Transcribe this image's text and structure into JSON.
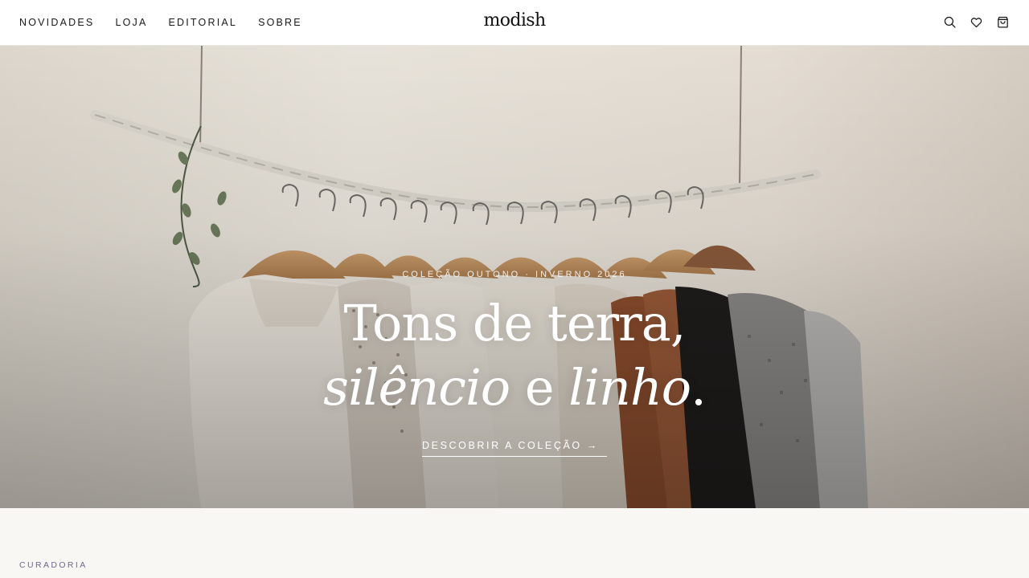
{
  "header": {
    "nav": [
      "NOVIDADES",
      "LOJA",
      "EDITORIAL",
      "SOBRE"
    ],
    "logo": "modish",
    "icons": [
      "search-icon",
      "heart-icon",
      "shopping-bag-icon"
    ]
  },
  "hero": {
    "eyebrow": "COLEÇÃO OUTONO · INVERNO 2026",
    "headline_line1": "Tons de terra,",
    "headline_italic1": "silêncio",
    "headline_mid": " e ",
    "headline_italic2": "linho",
    "headline_end": ".",
    "cta": "DESCOBRIR A COLEÇÃO →"
  },
  "section": {
    "label": "CURADORIA"
  },
  "colors": {
    "header_bg": "#ffffff",
    "page_bg": "#f8f7f4",
    "wall": "#e6e1d9",
    "section_label": "#6f6a8f"
  }
}
